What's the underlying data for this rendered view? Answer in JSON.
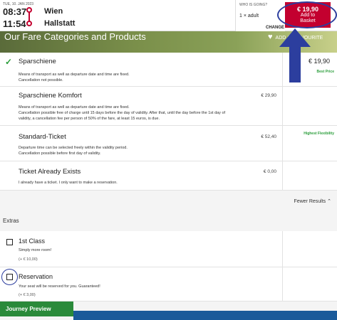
{
  "header": {
    "date": "TUE, 10. JAN 2023",
    "departure_time": "08:37",
    "arrival_time": "11:54",
    "from_station": "Wien",
    "to_station": "Hallstatt"
  },
  "who": {
    "title": "WHO IS GOING?",
    "value": "1 × adult",
    "change_label": "CHANGE"
  },
  "basket": {
    "price": "€ 19,90",
    "label_line1": "Add to",
    "label_line2": "Basket"
  },
  "banner": {
    "title": "Our Fare Categories and Products",
    "favourite_label": "ADD AS FAVOURITE"
  },
  "fares": [
    {
      "name": "Sparschiene",
      "desc_line1": "Means of transport as well as departure date and time are fixed.",
      "desc_line2": "Cancellation not possible.",
      "price": "",
      "side_price": "€ 19,90",
      "side_tag": "Best Price"
    },
    {
      "name": "Sparschiene Komfort",
      "desc_line1": "Means of transport as well as departure date and time are fixed.",
      "desc_line2": "Cancellation possible free of charge until 15 days before the day of validity. After that, until the day before the 1st day of",
      "desc_line3": "validity, a cancellation fee per person of 50% of the fare, at least 15 euros, is due.",
      "price": "€ 29,90"
    },
    {
      "name": "Standard-Ticket",
      "desc_line1": "Departure time can be selected freely within the validity period.",
      "desc_line2": "Cancellation possible before first day of validity.",
      "price": "€ 52,40",
      "side_tag": "Highest Flexibility"
    },
    {
      "name": "Ticket Already Exists",
      "desc_line1": "I already have a ticket. I only want to make a reservation.",
      "price": "€ 0,00"
    }
  ],
  "fewer_results": "Fewer Results",
  "extras": {
    "title": "Extras",
    "items": [
      {
        "name": "1st Class",
        "desc": "Simply more room!",
        "price": "(+ € 10,00)"
      },
      {
        "name": "Reservation",
        "desc": "Your seat will be reserved for you. Guaranteed!",
        "price": "(+ € 3,00)"
      }
    ]
  },
  "journey_preview": "Journey Preview",
  "colors": {
    "brand_red": "#c3002f",
    "accent_green": "#2a9d3a",
    "annotation_blue": "#2c3e9e"
  }
}
